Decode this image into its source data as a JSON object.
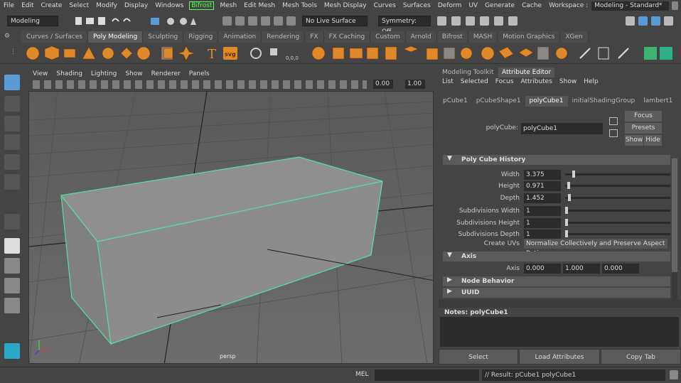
{
  "menubar": {
    "items": [
      "File",
      "Edit",
      "Create",
      "Select",
      "Modify",
      "Display",
      "Windows",
      "Bifrost",
      "Mesh",
      "Edit Mesh",
      "Mesh Tools",
      "Mesh Display",
      "Curves",
      "Surfaces",
      "Deform",
      "UV",
      "Generate",
      "Cache"
    ],
    "highlighted_item": "Bifrost",
    "workspace_label": "Workspace :",
    "workspace_value": "Modeling - Standard*"
  },
  "statusline": {
    "menuset": "Modeling",
    "live_surface": "No Live Surface",
    "symmetry": "Symmetry: Off"
  },
  "shelf": {
    "tabs": [
      "Curves / Surfaces",
      "Poly Modeling",
      "Sculpting",
      "Rigging",
      "Animation",
      "Rendering",
      "FX",
      "FX Caching",
      "Custom",
      "Arnold",
      "Bifrost",
      "MASH",
      "Motion Graphics",
      "XGen"
    ],
    "active_tab": "Poly Modeling",
    "text_icons": {
      "type": "T",
      "svg": "svg",
      "coords": "0,0,0"
    }
  },
  "viewport": {
    "menu": [
      "View",
      "Shading",
      "Lighting",
      "Show",
      "Renderer",
      "Panels"
    ],
    "exposure": "0.00",
    "gamma": "1.00",
    "camera_label": "persp"
  },
  "panel": {
    "top_tabs": [
      "Modeling Toolkit",
      "Attribute Editor"
    ],
    "active_top_tab": "Attribute Editor",
    "menu": [
      "List",
      "Selected",
      "Focus",
      "Attributes",
      "Show",
      "Help"
    ],
    "node_tabs": [
      "pCube1",
      "pCubeShape1",
      "polyCube1",
      "initialShadingGroup",
      "lambert1"
    ],
    "active_node_tab": "polyCube1",
    "node_label": "polyCube:",
    "node_name": "polyCube1",
    "focus_btn": "Focus",
    "presets_btn": "Presets",
    "show_btn": "Show",
    "hide_btn": "Hide",
    "sections": {
      "history": "Poly Cube History",
      "axis": "Axis",
      "node_behavior": "Node Behavior",
      "uuid": "UUID"
    },
    "attributes": [
      {
        "label": "Width",
        "value": "3.375",
        "slider": 0.07
      },
      {
        "label": "Height",
        "value": "0.971",
        "slider": 0.02
      },
      {
        "label": "Depth",
        "value": "1.452",
        "slider": 0.03
      },
      {
        "label": "Subdivisions Width",
        "value": "1",
        "slider": 0.0
      },
      {
        "label": "Subdivisions Height",
        "value": "1",
        "slider": 0.0
      },
      {
        "label": "Subdivisions Depth",
        "value": "1",
        "slider": 0.0
      }
    ],
    "create_uvs_label": "Create UVs",
    "create_uvs_value": "Normalize Collectively and Preserve Aspect Ratio",
    "axis_label": "Axis",
    "axis_values": [
      "0.000",
      "1.000",
      "0.000"
    ],
    "notes_label": "Notes:",
    "notes_node": "polyCube1",
    "bottom_buttons": [
      "Select",
      "Load Attributes",
      "Copy Tab"
    ]
  },
  "cmdline": {
    "lang": "MEL",
    "result": "// Result: pCube1 polyCube1"
  },
  "colors": {
    "accent_blue": "#5b9bd5",
    "selection_green": "#55e0a0",
    "shelf_orange": "#e0892a"
  }
}
